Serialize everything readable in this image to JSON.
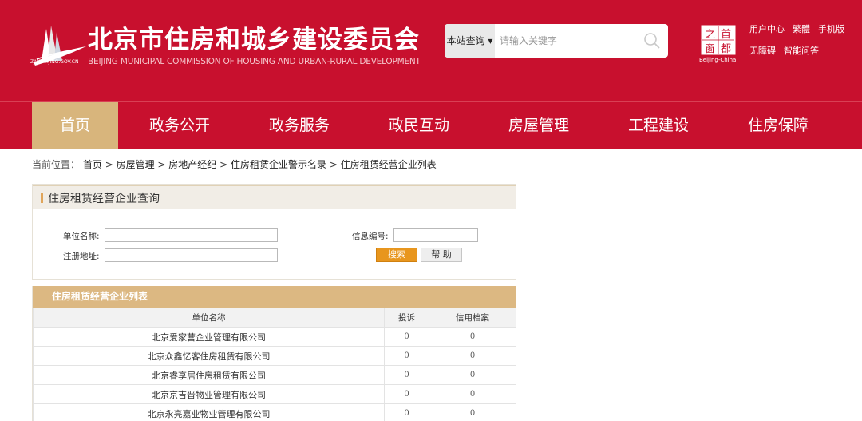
{
  "header": {
    "title": "北京市住房和城乡建设委员会",
    "subtitle": "BEIJING MUNICIPAL COMMISSION OF HOUSING AND URBAN-RURAL DEVELOPMENT",
    "logo_url_text": "ZJW.BEIJING.GOV.CN",
    "search": {
      "scope": "本站查询 ▾",
      "placeholder": "请输入关键字"
    },
    "seal_text": [
      "之",
      "首",
      "窗",
      "都"
    ],
    "seal_en": "Beijing-China",
    "links_row1": [
      "用户中心",
      "繁體",
      "手机版"
    ],
    "links_row2": [
      "无障碍",
      "智能问答"
    ],
    "brand_color": "#c8102e",
    "accent_color": "#d8b57c"
  },
  "nav": {
    "items": [
      "首页",
      "政务公开",
      "政务服务",
      "政民互动",
      "房屋管理",
      "工程建设",
      "住房保障"
    ],
    "active": "首页"
  },
  "breadcrumb": {
    "label": "当前位置：",
    "items": [
      "首页",
      "房屋管理",
      "房地产经纪",
      "住房租赁企业警示名录",
      "住房租赁经营企业列表"
    ],
    "sep": " > "
  },
  "query": {
    "title": "住房租赁经营企业查询",
    "unit_name_label": "单位名称:",
    "unit_name_value": "",
    "info_no_label": "信息编号:",
    "info_no_value": "",
    "address_label": "注册地址:",
    "address_value": "",
    "search_button": "搜索",
    "help_button": "帮 助"
  },
  "list": {
    "title": "住房租赁经营企业列表",
    "columns": [
      "单位名称",
      "投诉",
      "信用档案"
    ],
    "rows": [
      [
        "北京爱家营企业管理有限公司",
        "0",
        "0"
      ],
      [
        "北京众鑫忆客住房租赁有限公司",
        "0",
        "0"
      ],
      [
        "北京睿享居住房租赁有限公司",
        "0",
        "0"
      ],
      [
        "北京京吉晋物业管理有限公司",
        "0",
        "0"
      ],
      [
        "北京永亮嘉业物业管理有限公司",
        "0",
        "0"
      ]
    ]
  }
}
